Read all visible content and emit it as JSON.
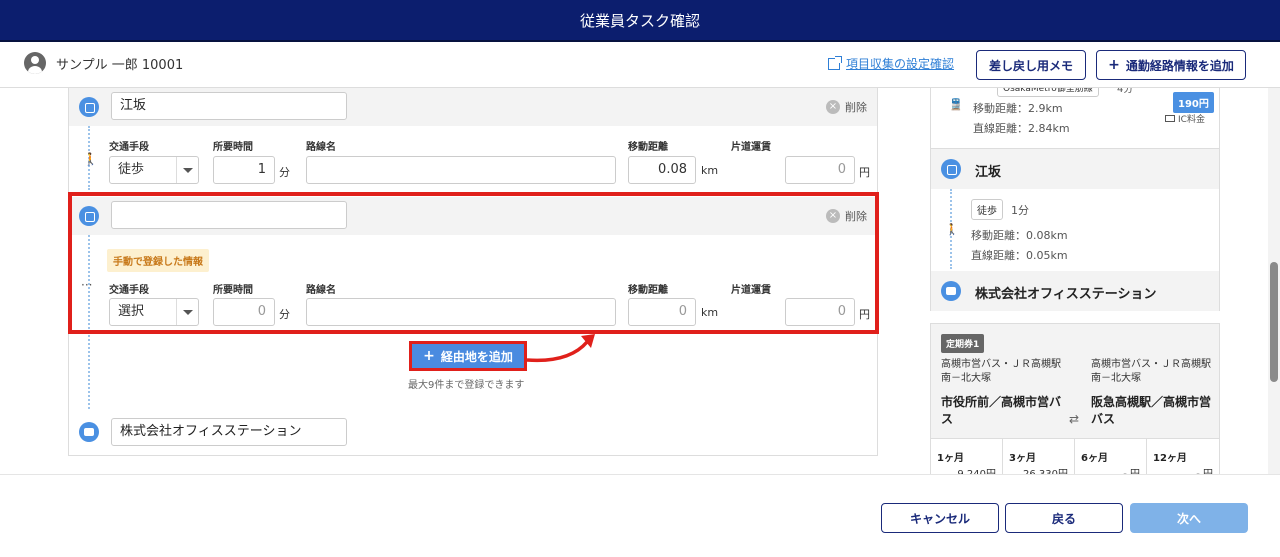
{
  "header": {
    "title": "従業員タスク確認"
  },
  "subheader": {
    "user_name": "サンプル 一郎 10001",
    "settings_link": "項目収集の設定確認",
    "memo_button": "差し戻し用メモ",
    "add_route_button": "通勤経路情報を追加",
    "plus": "+"
  },
  "left": {
    "stop1": {
      "name": "江坂",
      "delete": "削除"
    },
    "segment1": {
      "labels": {
        "mode": "交通手段",
        "time": "所要時間",
        "line": "路線名",
        "distance": "移動距離",
        "fare": "片道運賃"
      },
      "mode": "徒歩",
      "time": "1",
      "time_unit": "分",
      "line": "",
      "distance": "0.08",
      "distance_unit": "km",
      "fare": "0",
      "fare_unit": "円",
      "walk_icon": "🚶"
    },
    "stop2": {
      "name": "",
      "delete": "削除"
    },
    "segment2": {
      "badge": "手動で登録した情報",
      "labels": {
        "mode": "交通手段",
        "time": "所要時間",
        "line": "路線名",
        "distance": "移動距離",
        "fare": "片道運賃"
      },
      "mode": "選択",
      "time": "0",
      "time_unit": "分",
      "line": "",
      "distance": "0",
      "distance_unit": "km",
      "fare": "0",
      "fare_unit": "円",
      "dots": "···"
    },
    "add_waypoint": {
      "label": "経由地を追加",
      "plus": "+",
      "note": "最大9件まで登録できます"
    },
    "destination": {
      "name": "株式会社オフィスステーション"
    }
  },
  "right": {
    "top_card": {
      "line_tag": "OsakaMetro御堂筋線",
      "line_time": "4分",
      "fare": "190円",
      "ic": "IC料金",
      "moving_distance": "移動距離：2.9km",
      "straight_distance": "直線距離：2.84km"
    },
    "esaka": {
      "name": "江坂"
    },
    "walk_segment": {
      "tag": "徒歩",
      "time": "1分",
      "moving_distance": "移動距離：0.08km",
      "straight_distance": "直線距離：0.05km"
    },
    "office": {
      "name": "株式会社オフィスステーション"
    },
    "pass": {
      "tag": "定期券1",
      "from_small": "高槻市営バス・ＪＲ高槻駅南－北大塚",
      "to_small": "高槻市営バス・ＪＲ高槻駅南－北大塚",
      "from_big": "市役所前／高槻市営バス",
      "to_big": "阪急高槻駅／高槻市営バス",
      "swap": "⇄",
      "months": [
        {
          "label": "1ヶ月",
          "value": "9,240円"
        },
        {
          "label": "3ヶ月",
          "value": "26,330円"
        },
        {
          "label": "6ヶ月",
          "value": "- 円"
        },
        {
          "label": "12ヶ月",
          "value": "- 円"
        }
      ]
    }
  },
  "footer": {
    "cancel": "キャンセル",
    "back": "戻る",
    "next": "次へ"
  },
  "colors": {
    "header": "#0c1e6e",
    "accent": "#4a90e2",
    "highlight": "#e0201b"
  }
}
